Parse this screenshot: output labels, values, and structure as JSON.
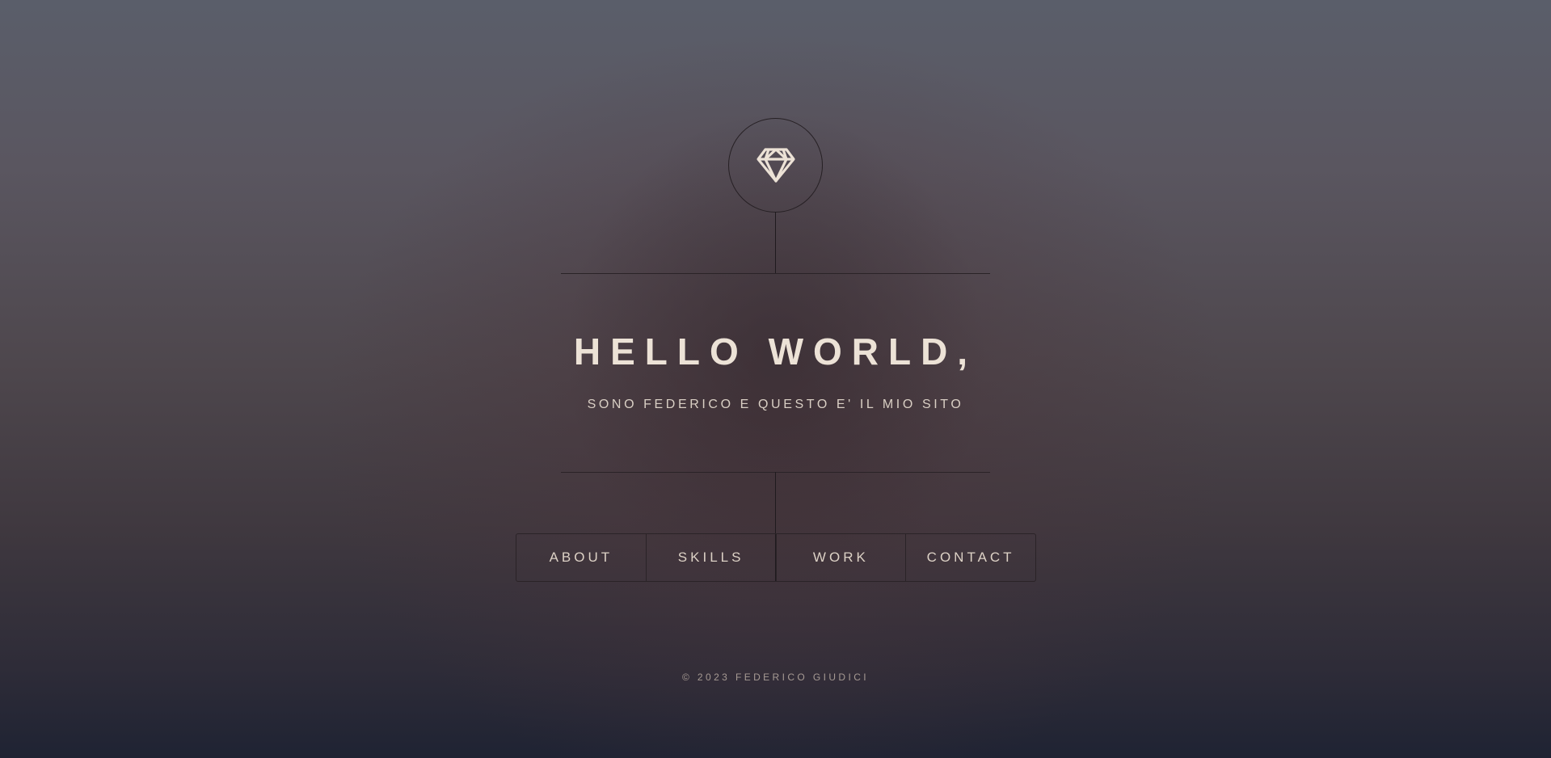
{
  "header": {
    "logo_icon": "diamond-icon",
    "title": "HELLO WORLD,",
    "subtitle": "SONO FEDERICO E QUESTO E' IL MIO SITO"
  },
  "nav": {
    "items": [
      {
        "label": "ABOUT"
      },
      {
        "label": "SKILLS"
      },
      {
        "label": "WORK"
      },
      {
        "label": "CONTACT"
      }
    ]
  },
  "footer": {
    "copyright": "© 2023 FEDERICO GIUDICI"
  },
  "colors": {
    "text": "#ece2d6",
    "lines": "#2a2327",
    "bg_top": "#5a5e6a",
    "bg_bottom": "#1f2333"
  }
}
